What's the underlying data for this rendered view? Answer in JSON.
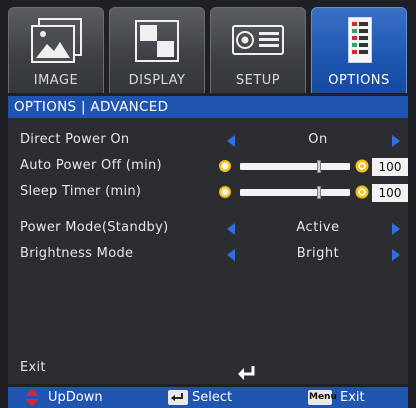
{
  "tabs": [
    {
      "label": "IMAGE",
      "active": false,
      "icon": "image-icon"
    },
    {
      "label": "DISPLAY",
      "active": false,
      "icon": "display-icon"
    },
    {
      "label": "SETUP",
      "active": false,
      "icon": "setup-icon"
    },
    {
      "label": "OPTIONS",
      "active": true,
      "icon": "options-icon"
    }
  ],
  "breadcrumb": "OPTIONS | ADVANCED",
  "menu": {
    "direct_power_on": {
      "label": "Direct Power On",
      "value": "On"
    },
    "auto_power_off": {
      "label": "Auto Power Off (min)",
      "value": "100",
      "level": 0.72
    },
    "sleep_timer": {
      "label": "Sleep Timer (min)",
      "value": "100",
      "level": 0.72
    },
    "power_mode": {
      "label": "Power Mode(Standby)",
      "value": "Active"
    },
    "brightness_mode": {
      "label": "Brightness Mode",
      "value": "Bright"
    },
    "exit": {
      "label": "Exit"
    }
  },
  "footer": {
    "updown": "UpDown",
    "select": "Select",
    "menu_key": "Menu",
    "exit": "Exit"
  },
  "colors": {
    "accent": "#1f55b0",
    "arrow": "#2f6fe0",
    "panel": "#2b2d31"
  }
}
